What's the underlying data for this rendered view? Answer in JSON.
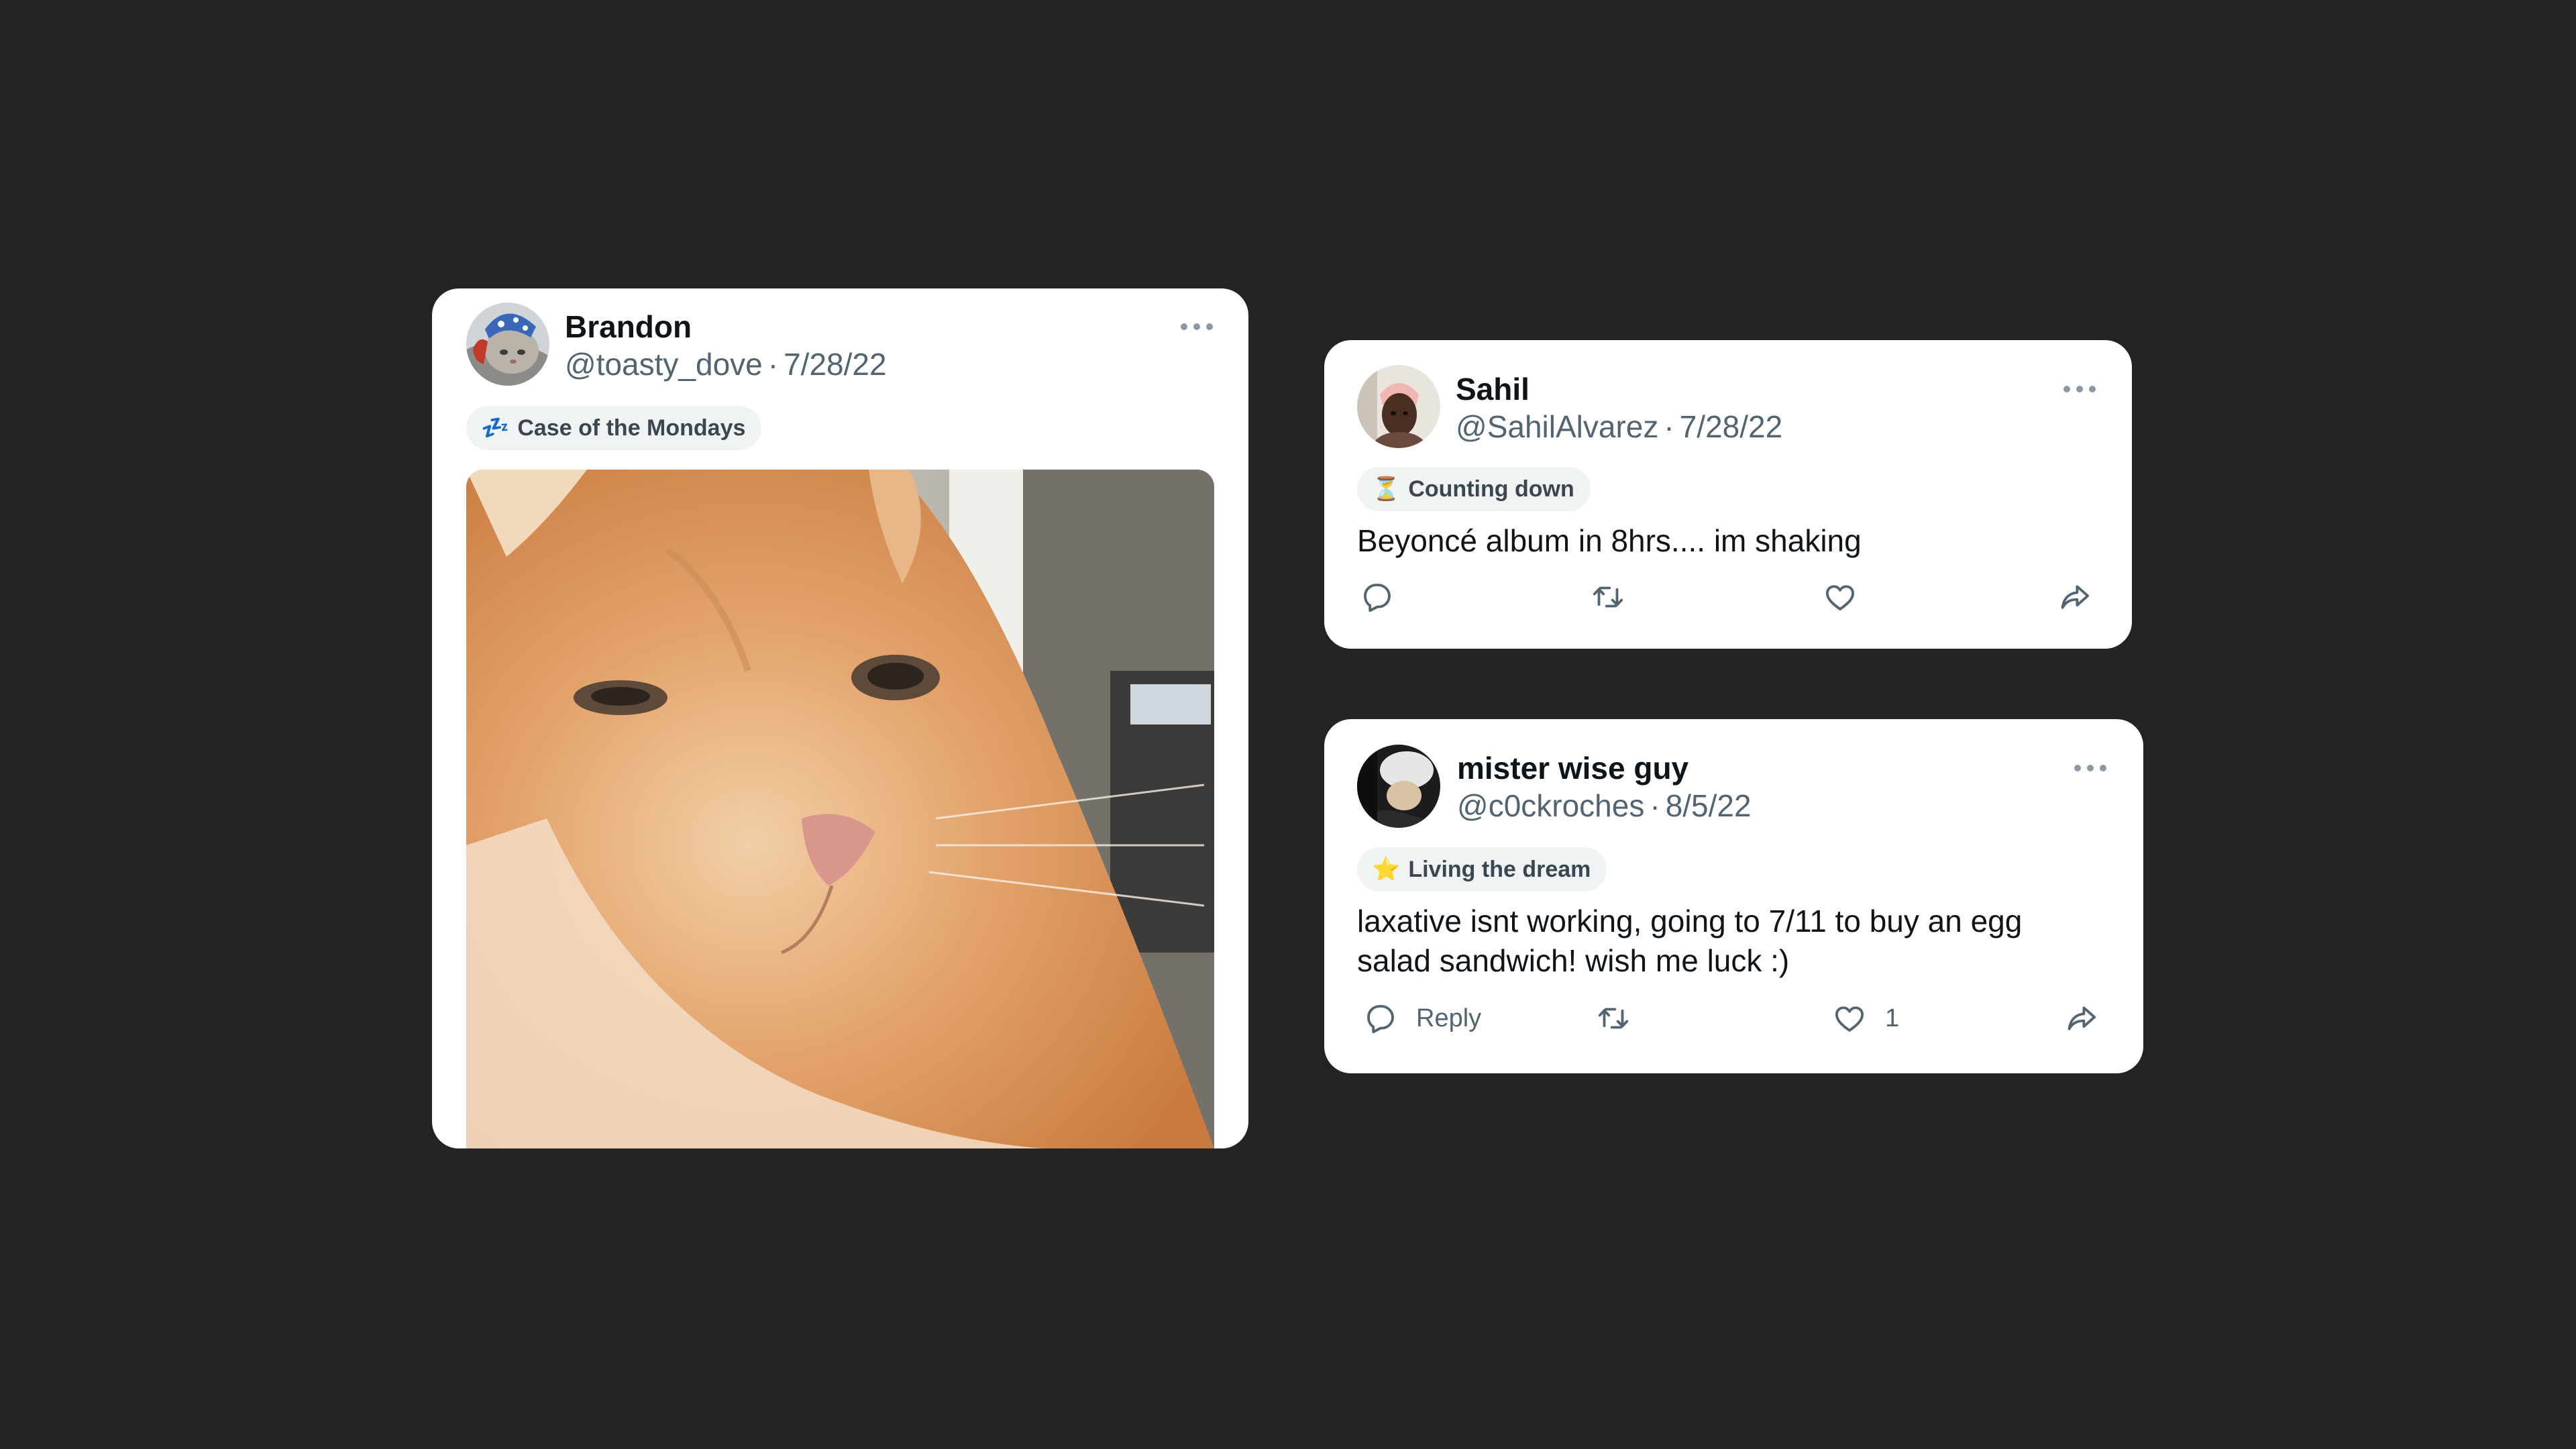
{
  "posts": [
    {
      "name": "Brandon",
      "handle": "@toasty_dove",
      "date": "7/28/22",
      "status": {
        "emoji": "💤",
        "label": "Case of the Mondays"
      },
      "text": "",
      "has_image": true,
      "image_subject": "orange cat close-up"
    },
    {
      "name": "Sahil",
      "handle": "@SahilAlvarez",
      "date": "7/28/22",
      "status": {
        "emoji": "⏳",
        "label": "Counting down"
      },
      "text": "Beyoncé album in 8hrs.... im shaking",
      "actions": {
        "reply_label": "",
        "like_count": ""
      }
    },
    {
      "name": "mister wise guy",
      "handle": "@c0ckroches",
      "date": "8/5/22",
      "status": {
        "emoji": "⭐",
        "label": "Living the dream"
      },
      "text_lines": [
        "laxative isnt working, going to 7/11 to buy an egg",
        "salad sandwich! wish me luck :)"
      ],
      "actions": {
        "reply_label": "Reply",
        "like_count": "1"
      }
    }
  ],
  "separator": "·",
  "colors": {
    "background": "#232323",
    "card": "#ffffff",
    "text_primary": "#0f1419",
    "text_secondary": "#536471",
    "status_pill": "#eff3f4",
    "star": "#f5a623"
  },
  "icons": [
    "more-icon",
    "reply-icon",
    "retweet-icon",
    "like-icon",
    "share-icon"
  ]
}
